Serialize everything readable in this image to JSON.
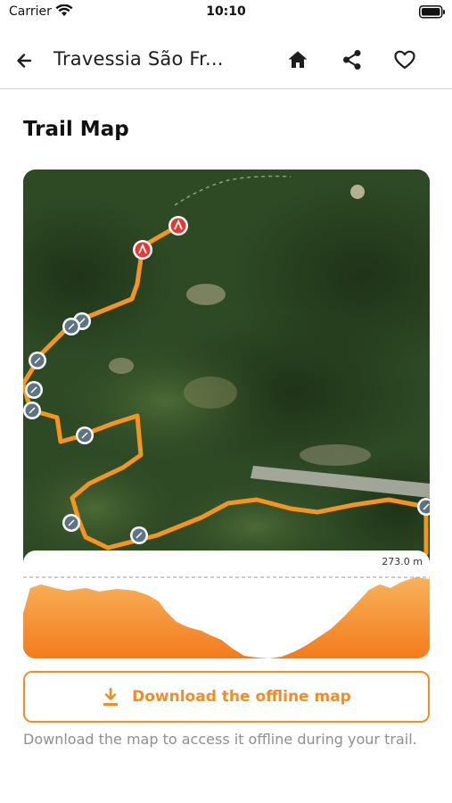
{
  "status_bar": {
    "carrier": "Carrier",
    "time": "10:10"
  },
  "nav": {
    "title": "Travessia São Fr...",
    "icons": [
      "back-arrow-icon",
      "home-icon",
      "share-icon",
      "heart-icon"
    ]
  },
  "section": {
    "title": "Trail Map"
  },
  "map": {
    "elevation_max_label": "273.0 m",
    "route_color": "#f7941d",
    "marker_red": "#e53935",
    "marker_gray": "#5f7482"
  },
  "download": {
    "button_label": "Download the offline map",
    "helper_text": "Download the map to access it offline during your trail."
  },
  "colors": {
    "accent": "#f28c28",
    "text_secondary": "#8e8e93"
  }
}
